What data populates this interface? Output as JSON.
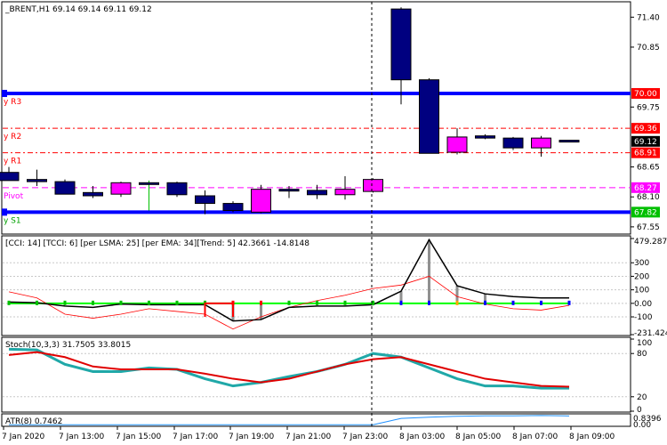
{
  "colors": {
    "frame": "#000000",
    "grid": "#c8c8c8",
    "bull_candle": "#ff00ff",
    "bear_candle": "#000080",
    "blue_level": "#0000ff",
    "red_level": "#ff0000",
    "pivot_line": "#ff00ff",
    "cci_line": "#000000",
    "cci_ma": "#ff0000",
    "cci_trend": "#00ff00",
    "stoch_main": "#20a8a8",
    "stoch_signal": "#e00000",
    "atr": "#1e90ff",
    "price_box_red": "#ff0000",
    "price_box_magenta": "#ff00ff",
    "price_box_blue": "#0000ff",
    "price_box_green": "#00c000",
    "price_box_black": "#000000"
  },
  "main_panel": {
    "header": "_BRENT,H1  69.14 69.14 69.11 69.12",
    "level_labels": [
      {
        "name": "r3",
        "text": "y R3",
        "color": "#ff0000",
        "price": 70.0
      },
      {
        "name": "r2",
        "text": "y R2",
        "color": "#ff0000",
        "price": 69.36
      },
      {
        "name": "r1",
        "text": "y R1",
        "color": "#ff0000",
        "price": 68.91
      },
      {
        "name": "pivot",
        "text": "Pivot",
        "color": "#ff00ff",
        "price": 68.27
      },
      {
        "name": "s1",
        "text": "y S1",
        "color": "#00a000",
        "price": 67.82
      }
    ],
    "price_ticks": [
      "71.40",
      "70.85",
      "69.75",
      "68.65",
      "68.10",
      "67.55"
    ],
    "price_boxes": [
      {
        "text": "70.00",
        "color": "#ff0000",
        "price": 70.0
      },
      {
        "text": "69.36",
        "color": "#ff0000",
        "price": 69.36
      },
      {
        "text": "69.12",
        "color": "#000000",
        "price": 69.12
      },
      {
        "text": "68.91",
        "color": "#ff0000",
        "price": 68.91
      },
      {
        "text": "68.27",
        "color": "#ff00ff",
        "price": 68.27
      },
      {
        "text": "67.82",
        "color": "#00c000",
        "price": 67.82
      }
    ]
  },
  "cci_panel": {
    "header": "[CCI: 14] [TCCI: 6] [per LSMA: 25] [per EMA: 34][Trend: 5]  42.3661 -14.8148",
    "ticks": [
      "479.2874",
      "300",
      "200",
      "100",
      "0.00",
      "-100",
      "-231.424"
    ]
  },
  "stoch_panel": {
    "header": "Stoch(10,3,3) 31.7505 33.8015",
    "ticks": [
      "100",
      "80",
      "20",
      "0"
    ]
  },
  "atr_panel": {
    "header": "ATR(8) 0.7462",
    "ticks": [
      "0.8396",
      "0.00"
    ]
  },
  "time_axis": [
    "7 Jan 2020",
    "7 Jan 13:00",
    "7 Jan 15:00",
    "7 Jan 17:00",
    "7 Jan 19:00",
    "7 Jan 21:00",
    "7 Jan 23:00",
    "8 Jan 03:00",
    "8 Jan 05:00",
    "8 Jan 07:00",
    "8 Jan 09:00"
  ],
  "chart_data": {
    "type": "candlestick",
    "price_range": [
      67.45,
      71.65
    ],
    "candles": [
      {
        "o": 68.55,
        "h": 68.65,
        "l": 68.4,
        "c": 68.4
      },
      {
        "o": 68.42,
        "h": 68.6,
        "l": 68.3,
        "c": 68.38
      },
      {
        "o": 68.38,
        "h": 68.42,
        "l": 68.15,
        "c": 68.15
      },
      {
        "o": 68.18,
        "h": 68.3,
        "l": 68.08,
        "c": 68.12
      },
      {
        "o": 68.15,
        "h": 68.38,
        "l": 68.1,
        "c": 68.36
      },
      {
        "o": 68.36,
        "h": 68.4,
        "l": 67.85,
        "c": 68.34
      },
      {
        "o": 68.36,
        "h": 68.38,
        "l": 68.1,
        "c": 68.14
      },
      {
        "o": 68.12,
        "h": 68.22,
        "l": 67.78,
        "c": 67.98
      },
      {
        "o": 67.98,
        "h": 68.02,
        "l": 67.82,
        "c": 67.85
      },
      {
        "o": 67.82,
        "h": 68.32,
        "l": 67.8,
        "c": 68.24
      },
      {
        "o": 68.24,
        "h": 68.3,
        "l": 68.08,
        "c": 68.22
      },
      {
        "o": 68.22,
        "h": 68.32,
        "l": 68.06,
        "c": 68.14
      },
      {
        "o": 68.14,
        "h": 68.48,
        "l": 68.05,
        "c": 68.24
      },
      {
        "o": 68.2,
        "h": 68.44,
        "l": 68.18,
        "c": 68.42
      },
      {
        "o": 71.55,
        "h": 71.58,
        "l": 69.8,
        "c": 70.25
      },
      {
        "o": 70.25,
        "h": 70.28,
        "l": 68.9,
        "c": 68.9
      },
      {
        "o": 68.92,
        "h": 69.36,
        "l": 68.88,
        "c": 69.2
      },
      {
        "o": 69.22,
        "h": 69.25,
        "l": 69.16,
        "c": 69.18
      },
      {
        "o": 69.18,
        "h": 69.2,
        "l": 68.96,
        "c": 69.0
      },
      {
        "o": 69.0,
        "h": 69.22,
        "l": 68.84,
        "c": 69.18
      },
      {
        "o": 69.14,
        "h": 69.14,
        "l": 69.11,
        "c": 69.12
      }
    ],
    "levels": [
      {
        "name": "R3",
        "price": 70.0,
        "style": "solid-thick",
        "color": "#0000ff"
      },
      {
        "name": "R2",
        "price": 69.36,
        "style": "dashdot",
        "color": "#ff0000"
      },
      {
        "name": "R1",
        "price": 68.91,
        "style": "dashdot",
        "color": "#ff0000"
      },
      {
        "name": "Pivot",
        "price": 68.27,
        "style": "dashed",
        "color": "#ff00ff"
      },
      {
        "name": "S1",
        "price": 67.82,
        "style": "solid-thick",
        "color": "#0000ff"
      }
    ],
    "cci_range": [
      -231.424,
      479.2874
    ],
    "cci": [
      10,
      5,
      -20,
      -30,
      -5,
      -10,
      -10,
      -10,
      -130,
      -120,
      -30,
      -20,
      -20,
      -10,
      90,
      470,
      130,
      70,
      50,
      40,
      40
    ],
    "cci_ma": [
      85,
      40,
      -80,
      -110,
      -80,
      -40,
      -60,
      -80,
      -190,
      -100,
      -30,
      20,
      60,
      110,
      135,
      200,
      50,
      -5,
      -40,
      -50,
      -15
    ],
    "stoch_range": [
      0,
      100
    ],
    "stoch_main": [
      86,
      85,
      65,
      55,
      55,
      60,
      58,
      45,
      35,
      40,
      48,
      55,
      65,
      80,
      75,
      60,
      45,
      35,
      35,
      32,
      32
    ],
    "stoch_signal": [
      78,
      82,
      75,
      62,
      58,
      58,
      58,
      52,
      45,
      40,
      45,
      55,
      65,
      72,
      75,
      65,
      55,
      45,
      40,
      35,
      34
    ],
    "atr_range": [
      0,
      0.8396
    ],
    "atr": [
      0.05,
      0.05,
      0.05,
      0.05,
      0.05,
      0.05,
      0.05,
      0.05,
      0.05,
      0.05,
      0.05,
      0.05,
      0.05,
      0.05,
      0.55,
      0.65,
      0.72,
      0.75,
      0.75,
      0.78,
      0.7462
    ]
  }
}
